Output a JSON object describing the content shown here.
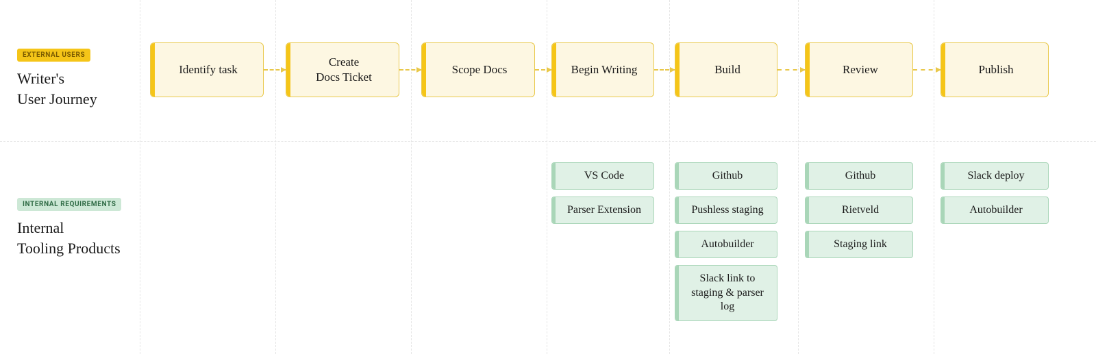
{
  "colors": {
    "stage_border": "#e9c84a",
    "stage_fill": "#fdf7e2",
    "stage_accent": "#f5c518",
    "tool_border": "#a9d6b8",
    "tool_fill": "#e0f1e6",
    "tool_accent": "#a9d6b8",
    "grid_line": "#e5e5e5"
  },
  "rows": {
    "top": {
      "badge": "EXTERNAL USERS",
      "title": "Writer's\nUser Journey"
    },
    "bottom": {
      "badge": "INTERNAL REQUIREMENTS",
      "title": "Internal\nTooling Products"
    }
  },
  "stages": [
    {
      "id": "identify",
      "label": "Identify task"
    },
    {
      "id": "create_ticket",
      "label": "Create\nDocs Ticket"
    },
    {
      "id": "scope",
      "label": "Scope Docs"
    },
    {
      "id": "begin_writing",
      "label": "Begin Writing"
    },
    {
      "id": "build",
      "label": "Build"
    },
    {
      "id": "review",
      "label": "Review"
    },
    {
      "id": "publish",
      "label": "Publish"
    }
  ],
  "tooling": {
    "begin_writing": [
      "VS Code",
      "Parser Extension"
    ],
    "build": [
      "Github",
      "Pushless staging",
      "Autobuilder",
      "Slack link to staging & parser log"
    ],
    "review": [
      "Github",
      "Rietveld",
      "Staging link"
    ],
    "publish": [
      "Slack deploy",
      "Autobuilder"
    ]
  }
}
